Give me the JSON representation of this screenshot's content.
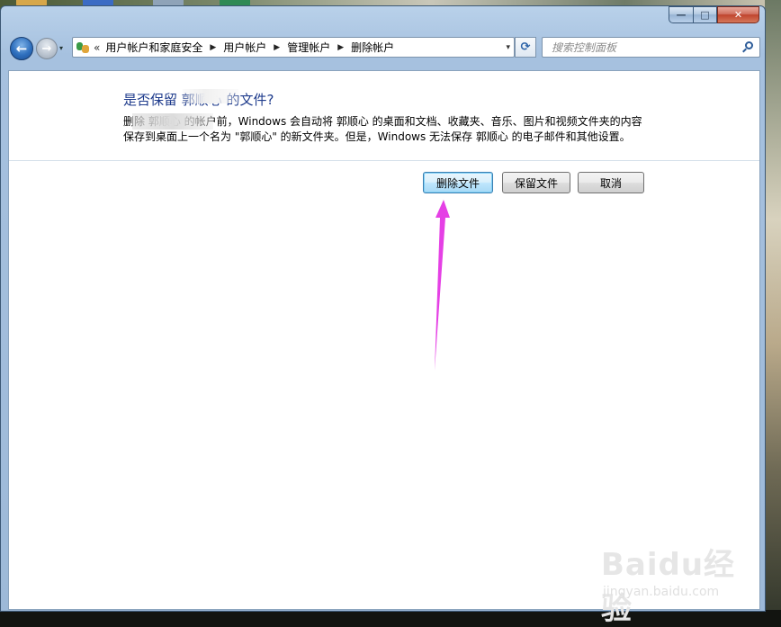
{
  "window": {
    "minimize": "—",
    "maximize": "□",
    "close": "✕"
  },
  "nav": {
    "back": "←",
    "forward": "→",
    "history": "▾"
  },
  "address": {
    "overflow": "«",
    "crumbs": [
      "用户帐户和家庭安全",
      "用户帐户",
      "管理帐户",
      "删除帐户"
    ],
    "separator": "▶",
    "dropdown": "▾"
  },
  "refresh": "⟳",
  "search": {
    "placeholder": "搜索控制面板"
  },
  "main": {
    "headline": "是否保留 郭顺心 的文件?",
    "description": "删除 郭顺心 的帐户前，Windows 会自动将 郭顺心 的桌面和文档、收藏夹、音乐、图片和视频文件夹的内容\n保存到桌面上一个名为 \"郭顺心\" 的新文件夹。但是，Windows 无法保存 郭顺心 的电子邮件和其他设置。"
  },
  "buttons": {
    "delete_files": "删除文件",
    "keep_files": "保留文件",
    "cancel": "取消"
  },
  "watermark": {
    "logo": "Baidu经验",
    "sub": "jingyan.baidu.com"
  },
  "colors": {
    "headline": "#1e3b8c",
    "arrow": "#e540e5"
  }
}
